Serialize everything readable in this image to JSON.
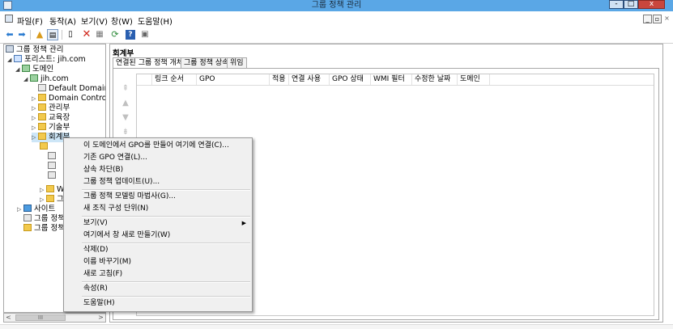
{
  "window": {
    "title": "그룹 정책 관리",
    "controls": {
      "minimize": "-",
      "maximize": "□",
      "close": "x"
    }
  },
  "menubar": {
    "items": [
      "파일(F)",
      "동작(A)",
      "보기(V)",
      "창(W)",
      "도움말(H)"
    ],
    "mdi_controls": {
      "minimize": "_",
      "restore": "▫",
      "close": "×"
    }
  },
  "toolbar": {
    "icons": [
      "back-arrow-icon",
      "forward-arrow-icon",
      "up-folder-icon",
      "show-tree-icon",
      "copy-icon",
      "delete-icon",
      "properties-icon",
      "refresh-icon",
      "help-icon",
      "console-icon"
    ]
  },
  "tree": {
    "root": "그룹 정책 관리",
    "forest": "포리스트: jih.com",
    "domains": "도메인",
    "domain": "jih.com",
    "children": [
      "Default Domain",
      "Domain Contro",
      "관리부",
      "교육장",
      "기술부",
      "회계부"
    ],
    "collapsed_suffixes": [
      "W",
      "그"
    ],
    "sites": "사이트",
    "modeling": "그룹 정책",
    "results": "그룹 정책"
  },
  "hscroll": {
    "thumb_label": "III",
    "left": "<",
    "right": ">"
  },
  "right_pane": {
    "title": "회계부",
    "tabs": [
      "연결된 그룹 정책 개체",
      "그룹 정책 상속",
      "위임"
    ],
    "columns": [
      "링크 순서",
      "GPO",
      "적용",
      "연결 사용",
      "GPO 상태",
      "WMI 필터",
      "수정한 날짜",
      "도메인"
    ]
  },
  "context_menu": {
    "items": [
      "이 도메인에서 GPO를 만들어 여기에 연결(C)...",
      "기존 GPO 연결(L)...",
      "상속 차단(B)",
      "그룹 정책 업데이트(U)...",
      "그룹 정책 모델링 마법사(G)...",
      "새 조직 구성 단위(N)",
      "보기(V)",
      "여기에서 창 새로 만들기(W)",
      "삭제(D)",
      "이름 바꾸기(M)",
      "새로 고침(F)",
      "속성(R)",
      "도움말(H)"
    ]
  }
}
